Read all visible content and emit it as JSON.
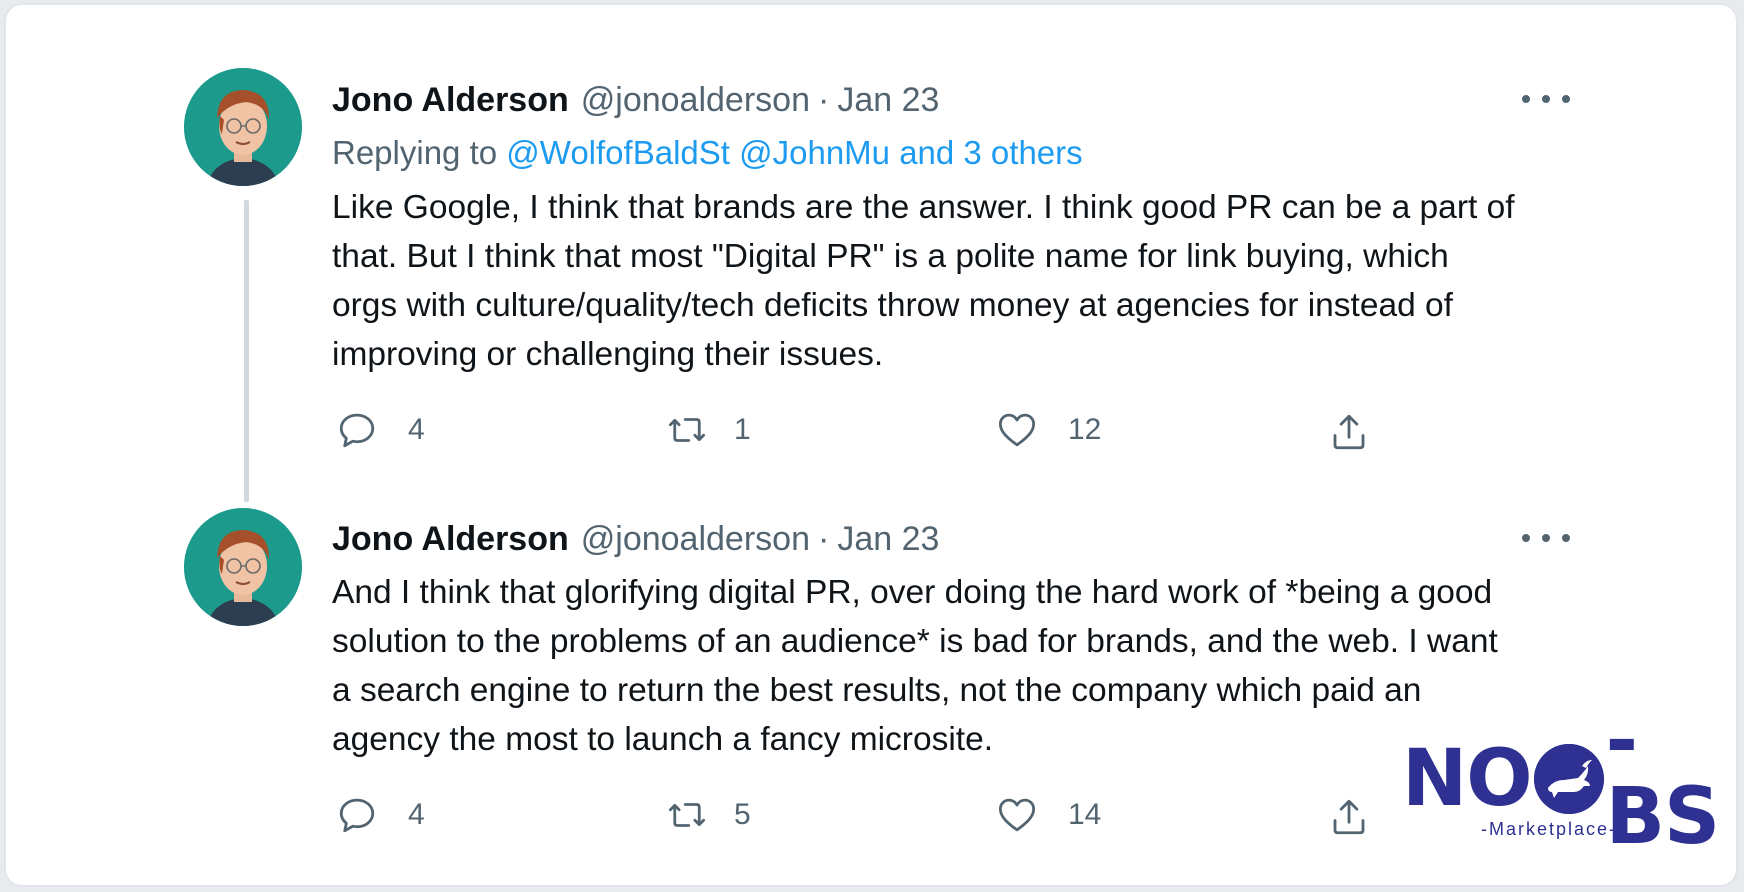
{
  "colors": {
    "text_primary": "#0f1419",
    "text_secondary": "#536471",
    "link": "#1d9bf0",
    "thread_line": "#cfd9de",
    "logo": "#2e3192"
  },
  "tweets": [
    {
      "display_name": "Jono Alderson",
      "handle": "@jonoalderson",
      "separator": "·",
      "date": "Jan 23",
      "avatar_icon": "avatar-portrait",
      "more_icon": "more-horizontal-icon",
      "replying_to": {
        "prefix": "Replying to",
        "mention_1": "@WolfofBaldSt",
        "mention_2": "@JohnMu",
        "others": "and 3 others"
      },
      "text_lines": [
        "Like Google, I think that brands are the answer. I think good PR can be a part of",
        "that. But I think that most \"Digital PR\" is a polite name for link buying, which",
        "orgs with culture/quality/tech deficits throw money at agencies for instead of",
        "improving or challenging their issues."
      ],
      "actions": {
        "reply": {
          "icon": "reply-icon",
          "count": "4"
        },
        "retweet": {
          "icon": "retweet-icon",
          "count": "1"
        },
        "like": {
          "icon": "like-icon",
          "count": "12"
        },
        "share": {
          "icon": "share-icon"
        }
      }
    },
    {
      "display_name": "Jono Alderson",
      "handle": "@jonoalderson",
      "separator": "·",
      "date": "Jan 23",
      "avatar_icon": "avatar-portrait",
      "more_icon": "more-horizontal-icon",
      "text_lines": [
        "And I think that glorifying digital PR, over doing the hard work of *being a good",
        "solution to the problems of an audience* is bad for brands, and the web. I want",
        "a search engine to return the best results, not the company which paid an",
        "agency the most to launch a fancy microsite."
      ],
      "actions": {
        "reply": {
          "icon": "reply-icon",
          "count": "4"
        },
        "retweet": {
          "icon": "retweet-icon",
          "count": "5"
        },
        "like": {
          "icon": "like-icon",
          "count": "14"
        },
        "share": {
          "icon": "share-icon"
        }
      }
    }
  ],
  "watermark": {
    "brand_left": "NO",
    "brand_right": "-BS",
    "tagline": "-Marketplace-",
    "icon": "bull-icon"
  }
}
